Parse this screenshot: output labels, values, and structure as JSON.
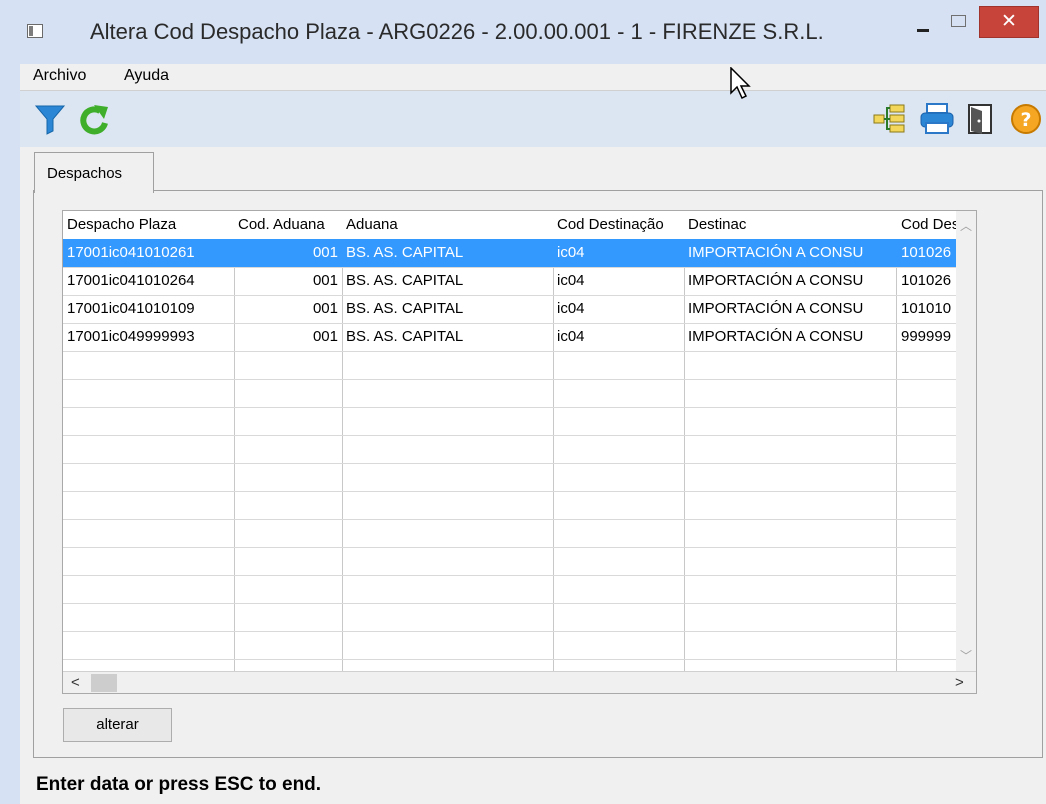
{
  "window": {
    "title": "Altera Cod Despacho Plaza - ARG0226 - 2.00.00.001 - 1 - FIRENZE S.R.L.",
    "minimize_glyph": "",
    "close_glyph": "✕"
  },
  "menu": {
    "items": [
      {
        "label": "Archivo"
      },
      {
        "label": "Ayuda"
      }
    ]
  },
  "toolbar": {
    "left_icons": [
      "filter-icon",
      "refresh-icon"
    ],
    "right_icons": [
      "tree-icon",
      "print-icon",
      "exit-door-icon",
      "help-icon"
    ]
  },
  "tabs": [
    {
      "label": "Despachos"
    }
  ],
  "grid": {
    "columns": [
      "Despacho Plaza",
      "Cod. Aduana",
      "Aduana",
      "Cod Destinação",
      "Destinac",
      "Cod Desp"
    ],
    "rows": [
      [
        "17001ic041010261",
        "001",
        "BS. AS. CAPITAL",
        "ic04",
        "IMPORTACIÓN A CONSU",
        "101026"
      ],
      [
        "17001ic041010264",
        "001",
        "BS. AS. CAPITAL",
        "ic04",
        "IMPORTACIÓN A CONSU",
        "101026"
      ],
      [
        "17001ic041010109",
        "001",
        "BS. AS. CAPITAL",
        "ic04",
        "IMPORTACIÓN A CONSU",
        "101010"
      ],
      [
        "17001ic049999993",
        "001",
        "BS. AS. CAPITAL",
        "ic04",
        "IMPORTACIÓN A CONSU",
        "999999"
      ]
    ],
    "selected_row": 0
  },
  "buttons": {
    "alter": "alterar"
  },
  "status": {
    "message": "Enter data or press ESC to end."
  },
  "colors": {
    "selection": "#3399ff",
    "toolbar_bg": "#dce6f2",
    "close_button": "#c7443a"
  }
}
